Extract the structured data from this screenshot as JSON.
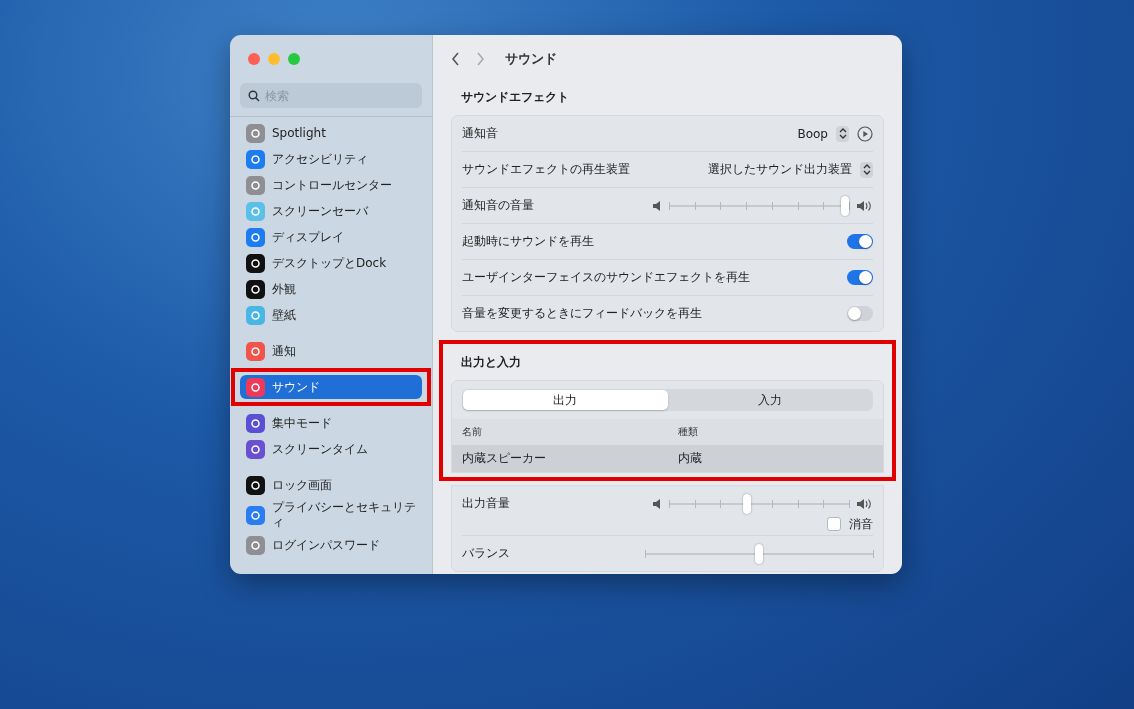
{
  "window": {
    "title": "サウンド"
  },
  "sidebar": {
    "search": {
      "placeholder": "検索"
    },
    "selected_framed": true,
    "groups": [
      [
        {
          "label": "Spotlight",
          "selected": false
        },
        {
          "label": "アクセシビリティ",
          "selected": false
        },
        {
          "label": "コントロールセンター",
          "selected": false
        },
        {
          "label": "スクリーンセーバ",
          "selected": false
        },
        {
          "label": "ディスプレイ",
          "selected": false
        },
        {
          "label": "デスクトップとDock",
          "selected": false
        },
        {
          "label": "外観",
          "selected": false
        },
        {
          "label": "壁紙",
          "selected": false
        }
      ],
      [
        {
          "label": "通知",
          "selected": false
        },
        {
          "label": "サウンド",
          "selected": true
        },
        {
          "label": "集中モード",
          "selected": false
        },
        {
          "label": "スクリーンタイム",
          "selected": false
        }
      ],
      [
        {
          "label": "ロック画面",
          "selected": false
        },
        {
          "label": "プライバシーとセキュリティ",
          "selected": false
        },
        {
          "label": "ログインパスワード",
          "selected": false
        }
      ]
    ]
  },
  "sound_effects": {
    "title": "サウンドエフェクト",
    "rows": [
      {
        "kind": "popup_play",
        "label": "通知音",
        "value": "Boop"
      },
      {
        "kind": "popup",
        "label": "サウンドエフェクトの再生装置",
        "value": "選択したサウンド出力装置"
      },
      {
        "kind": "volume",
        "label": "通知音の音量",
        "level": 1.0
      },
      {
        "kind": "toggle",
        "label": "起動時にサウンドを再生",
        "on": true
      },
      {
        "kind": "toggle",
        "label": "ユーザインターフェイスのサウンドエフェクトを再生",
        "on": true
      },
      {
        "kind": "toggle",
        "label": "音量を変更するときにフィードバックを再生",
        "on": false
      }
    ]
  },
  "output_input": {
    "title": "出力と入力",
    "annotated": true,
    "segments": [
      {
        "label": "出力",
        "selected": true
      },
      {
        "label": "入力",
        "selected": false
      }
    ],
    "columns": [
      "名前",
      "種類"
    ],
    "rows": [
      {
        "cells": [
          "内蔵スピーカー",
          "内蔵"
        ],
        "selected": true
      }
    ]
  },
  "output_controls": [
    {
      "kind": "volume",
      "label": "出力音量",
      "level": 0.43
    },
    {
      "kind": "checkbox",
      "label": "消音",
      "checked": false
    },
    {
      "kind": "balance",
      "label": "バランス",
      "level": 0.5
    }
  ]
}
